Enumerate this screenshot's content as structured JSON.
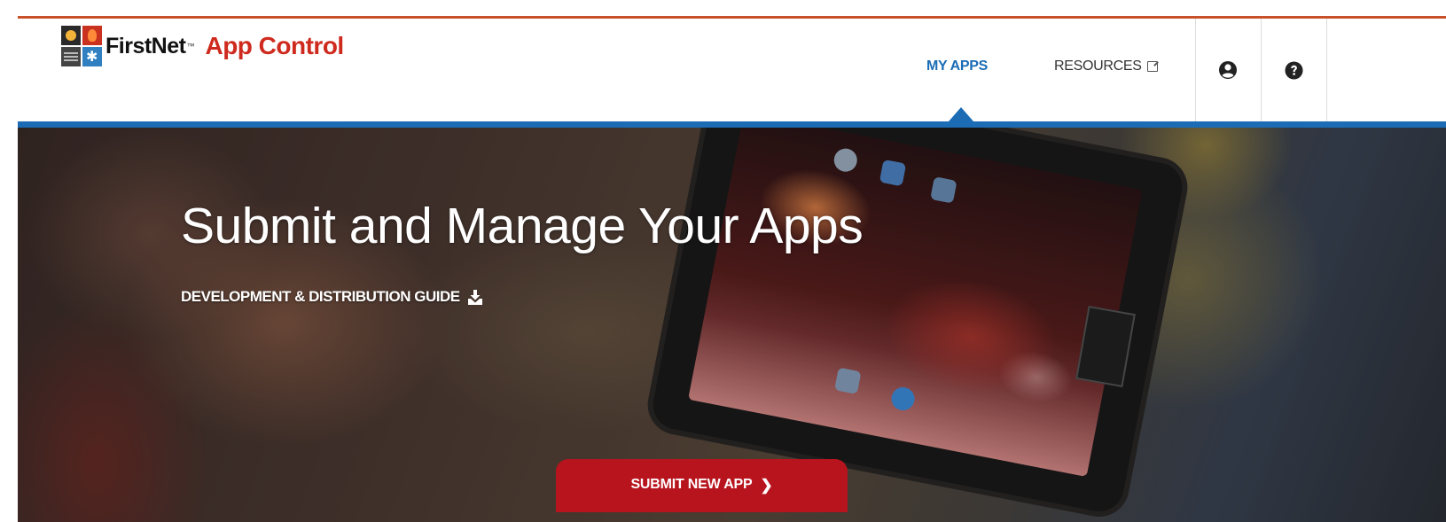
{
  "brand": {
    "name": "FirstNet",
    "trademark": "™",
    "product": "App Control",
    "logo_icon": "firstnet-logo-icon"
  },
  "nav": {
    "my_apps": "MY APPS",
    "resources": "RESOURCES",
    "resources_icon": "external-link-icon",
    "account_icon": "user-circle-icon",
    "help_icon": "help-circle-icon",
    "active_item": "MY APPS"
  },
  "hero": {
    "title": "Submit and Manage Your Apps",
    "guide_link": "DEVELOPMENT & DISTRIBUTION GUIDE",
    "guide_icon": "download-icon",
    "submit_button": "SUBMIT NEW APP",
    "submit_icon": "chevron-right-icon"
  },
  "colors": {
    "accent_blue": "#1b6cb5",
    "brand_red": "#cf2a1e",
    "button_red": "#b8141e",
    "top_rule": "#c8502a"
  }
}
